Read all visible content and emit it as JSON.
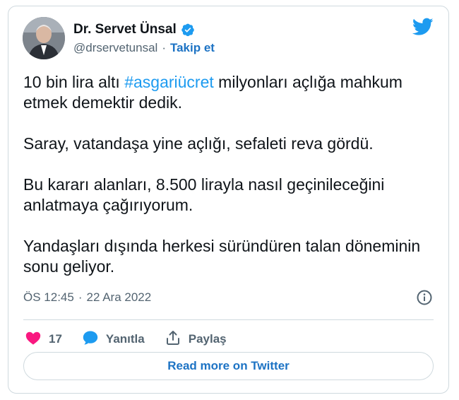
{
  "author": {
    "display_name": "Dr. Servet Ünsal",
    "handle": "@drservetunsal",
    "separator": "·",
    "follow_label": "Takip et",
    "verified": true
  },
  "tweet": {
    "paragraphs": [
      {
        "before": "10 bin lira altı ",
        "hashtag": "#asgariücret",
        "after": " milyonları açlığa mahkum etmek demektir dedik."
      },
      {
        "text": "Saray, vatandaşa yine açlığı, sefaleti reva gördü."
      },
      {
        "text": "Bu kararı alanları, 8.500 lirayla nasıl geçinileceğini anlatmaya çağırıyorum."
      },
      {
        "text": "Yandaşları dışında herkesi süründüren talan döneminin sonu geliyor."
      }
    ],
    "time": "ÖS 12:45",
    "date": "22 Ara 2022"
  },
  "actions": {
    "like_count": "17",
    "reply_label": "Yanıtla",
    "share_label": "Paylaş"
  },
  "read_more_label": "Read more on Twitter",
  "colors": {
    "accent": "#1d9bf0",
    "link": "#1d73c4",
    "like": "#f91880",
    "muted": "#536471",
    "border": "#cfd9de"
  },
  "icons": [
    "verified-badge-icon",
    "twitter-bird-icon",
    "info-icon",
    "heart-icon",
    "reply-bubble-icon",
    "share-icon"
  ]
}
